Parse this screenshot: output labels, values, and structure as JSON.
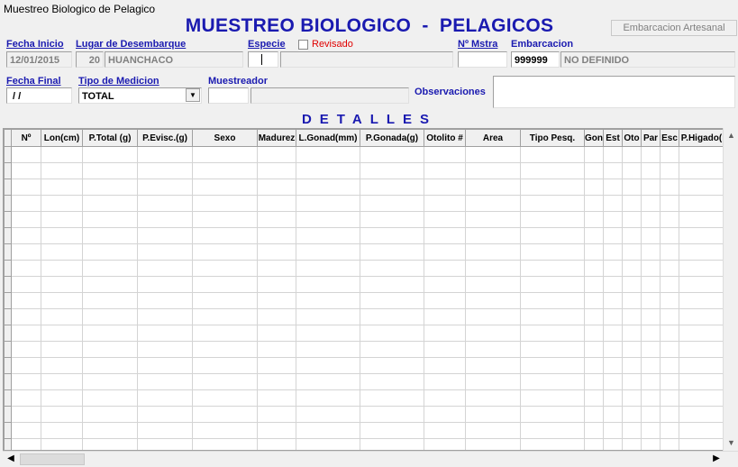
{
  "window": {
    "title": "Muestreo Biologico de Pelagico"
  },
  "header": {
    "main_title": "MUESTREO BIOLOGICO  -  PELAGICOS",
    "embarcacion_button": "Embarcacion Artesanal"
  },
  "form": {
    "fecha_inicio": {
      "label": "Fecha Inicio",
      "value": "12/01/2015"
    },
    "lugar_desembarque": {
      "label": "Lugar de Desembarque",
      "code": "20",
      "name": "HUANCHACO"
    },
    "especie": {
      "label": "Especie",
      "code": "",
      "name": ""
    },
    "revisado": {
      "label": "Revisado",
      "checked": false
    },
    "n_muestra": {
      "label": "Nº Mstra",
      "value": ""
    },
    "embarcacion": {
      "label": "Embarcacion",
      "code": "999999",
      "name": "NO DEFINIDO"
    },
    "fecha_final": {
      "label": "Fecha Final",
      "value": " / /"
    },
    "tipo_medicion": {
      "label": "Tipo de Medicion",
      "value": "TOTAL"
    },
    "muestreador": {
      "label": "Muestreador",
      "code": "",
      "name": ""
    },
    "observaciones": {
      "label": "Observaciones",
      "value": ""
    }
  },
  "detalles": {
    "title": "DETALLES",
    "columns": [
      "Nº",
      "Lon(cm)",
      "P.Total (g)",
      "P.Evisc.(g)",
      "Sexo",
      "Madurez",
      "L.Gonad(mm)",
      "P.Gonada(g)",
      "Otolito #",
      "Area",
      "Tipo Pesq.",
      "Gon",
      "Est",
      "Oto",
      "Par",
      "Esc",
      "P.Higado("
    ],
    "row_count": 19
  },
  "colors": {
    "accent": "#1a1ab0",
    "alert": "#e00000"
  },
  "icons": {
    "dropdown": "chevron-down-icon",
    "scroll_left": "arrow-left-icon",
    "scroll_right": "arrow-right-icon",
    "scroll_up": "arrow-up-icon",
    "scroll_down": "arrow-down-icon"
  }
}
